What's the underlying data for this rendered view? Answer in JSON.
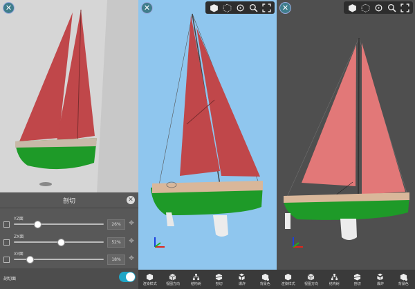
{
  "views": [
    {
      "id": "cut-view",
      "background": "#d6d6d6"
    },
    {
      "id": "sky-view",
      "background": "#8fc6ee"
    },
    {
      "id": "dark-view",
      "background": "#4f4f4f"
    }
  ],
  "close_glyph": "✕",
  "toolbar_icons": [
    "cube-icon",
    "dotted-cube-icon",
    "rotate-reset-icon",
    "zoom-fit-icon",
    "fullscreen-icon"
  ],
  "cut_panel": {
    "title": "剖切",
    "close_glyph": "✕",
    "planes": [
      {
        "label": "YZ面",
        "percent": "26%",
        "value": 0.26
      },
      {
        "label": "ZX面",
        "percent": "52%",
        "value": 0.52
      },
      {
        "label": "XY面",
        "percent": "18%",
        "value": 0.18
      }
    ],
    "footer_label": "剖切面",
    "toggle_on": true
  },
  "bottom_bar": {
    "items": [
      {
        "label": "渲染样式",
        "icon": "render-style-icon"
      },
      {
        "label": "视图方向",
        "icon": "view-direction-icon"
      },
      {
        "label": "结构树",
        "icon": "tree-icon"
      },
      {
        "label": "剖切",
        "icon": "cut-icon"
      },
      {
        "label": "爆炸",
        "icon": "explode-icon"
      },
      {
        "label": "背景色",
        "icon": "background-color-icon"
      }
    ]
  },
  "colors": {
    "sail_red": "#c0474a",
    "hull_green": "#1e9a28",
    "sail_pink": "#e27878",
    "accent": "#1fa6c7"
  }
}
